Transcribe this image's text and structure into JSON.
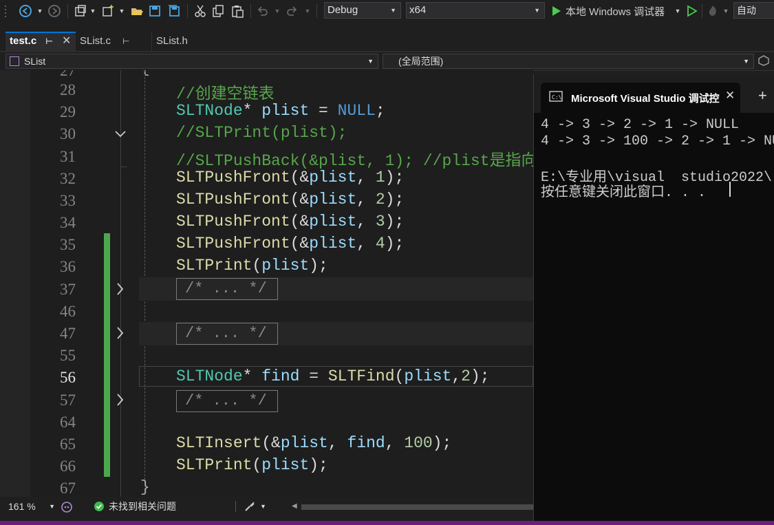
{
  "toolbar": {
    "config": "Debug",
    "platform": "x64",
    "debugger_label": "本地 Windows 调试器",
    "auto_label": "自动"
  },
  "tabs": [
    {
      "label": "test.c"
    },
    {
      "label": "SList.c"
    },
    {
      "label": "SList.h"
    }
  ],
  "navbar": {
    "project": "SList",
    "scope": "(全局范围)"
  },
  "editor": {
    "line_numbers": [
      "28",
      "29",
      "30",
      "31",
      "32",
      "33",
      "34",
      "35",
      "36",
      "37",
      "46",
      "47",
      "55",
      "56",
      "57",
      "64",
      "65",
      "66",
      "67"
    ],
    "folded_placeholder": "/* ... */",
    "partial_top_number": "27"
  },
  "console": {
    "title": "Microsoft Visual Studio 调试控",
    "lines": [
      "4 -> 3 -> 2 -> 1 -> NULL",
      "4 -> 3 -> 100 -> 2 -> 1 -> NU",
      "",
      "E:\\专业用\\visual  studio2022\\",
      "按任意键关闭此窗口. . ."
    ]
  },
  "status": {
    "zoom": "161 %",
    "issues": "未找到相关问题"
  },
  "colors": {
    "accent": "#0078d4",
    "comment": "#57a64a",
    "type": "#4ec9b0",
    "variable": "#9cdcfe",
    "function": "#dcdcaa",
    "number": "#b5cea8",
    "change_bar": "#4ca84c",
    "status_bar": "#68217a"
  }
}
